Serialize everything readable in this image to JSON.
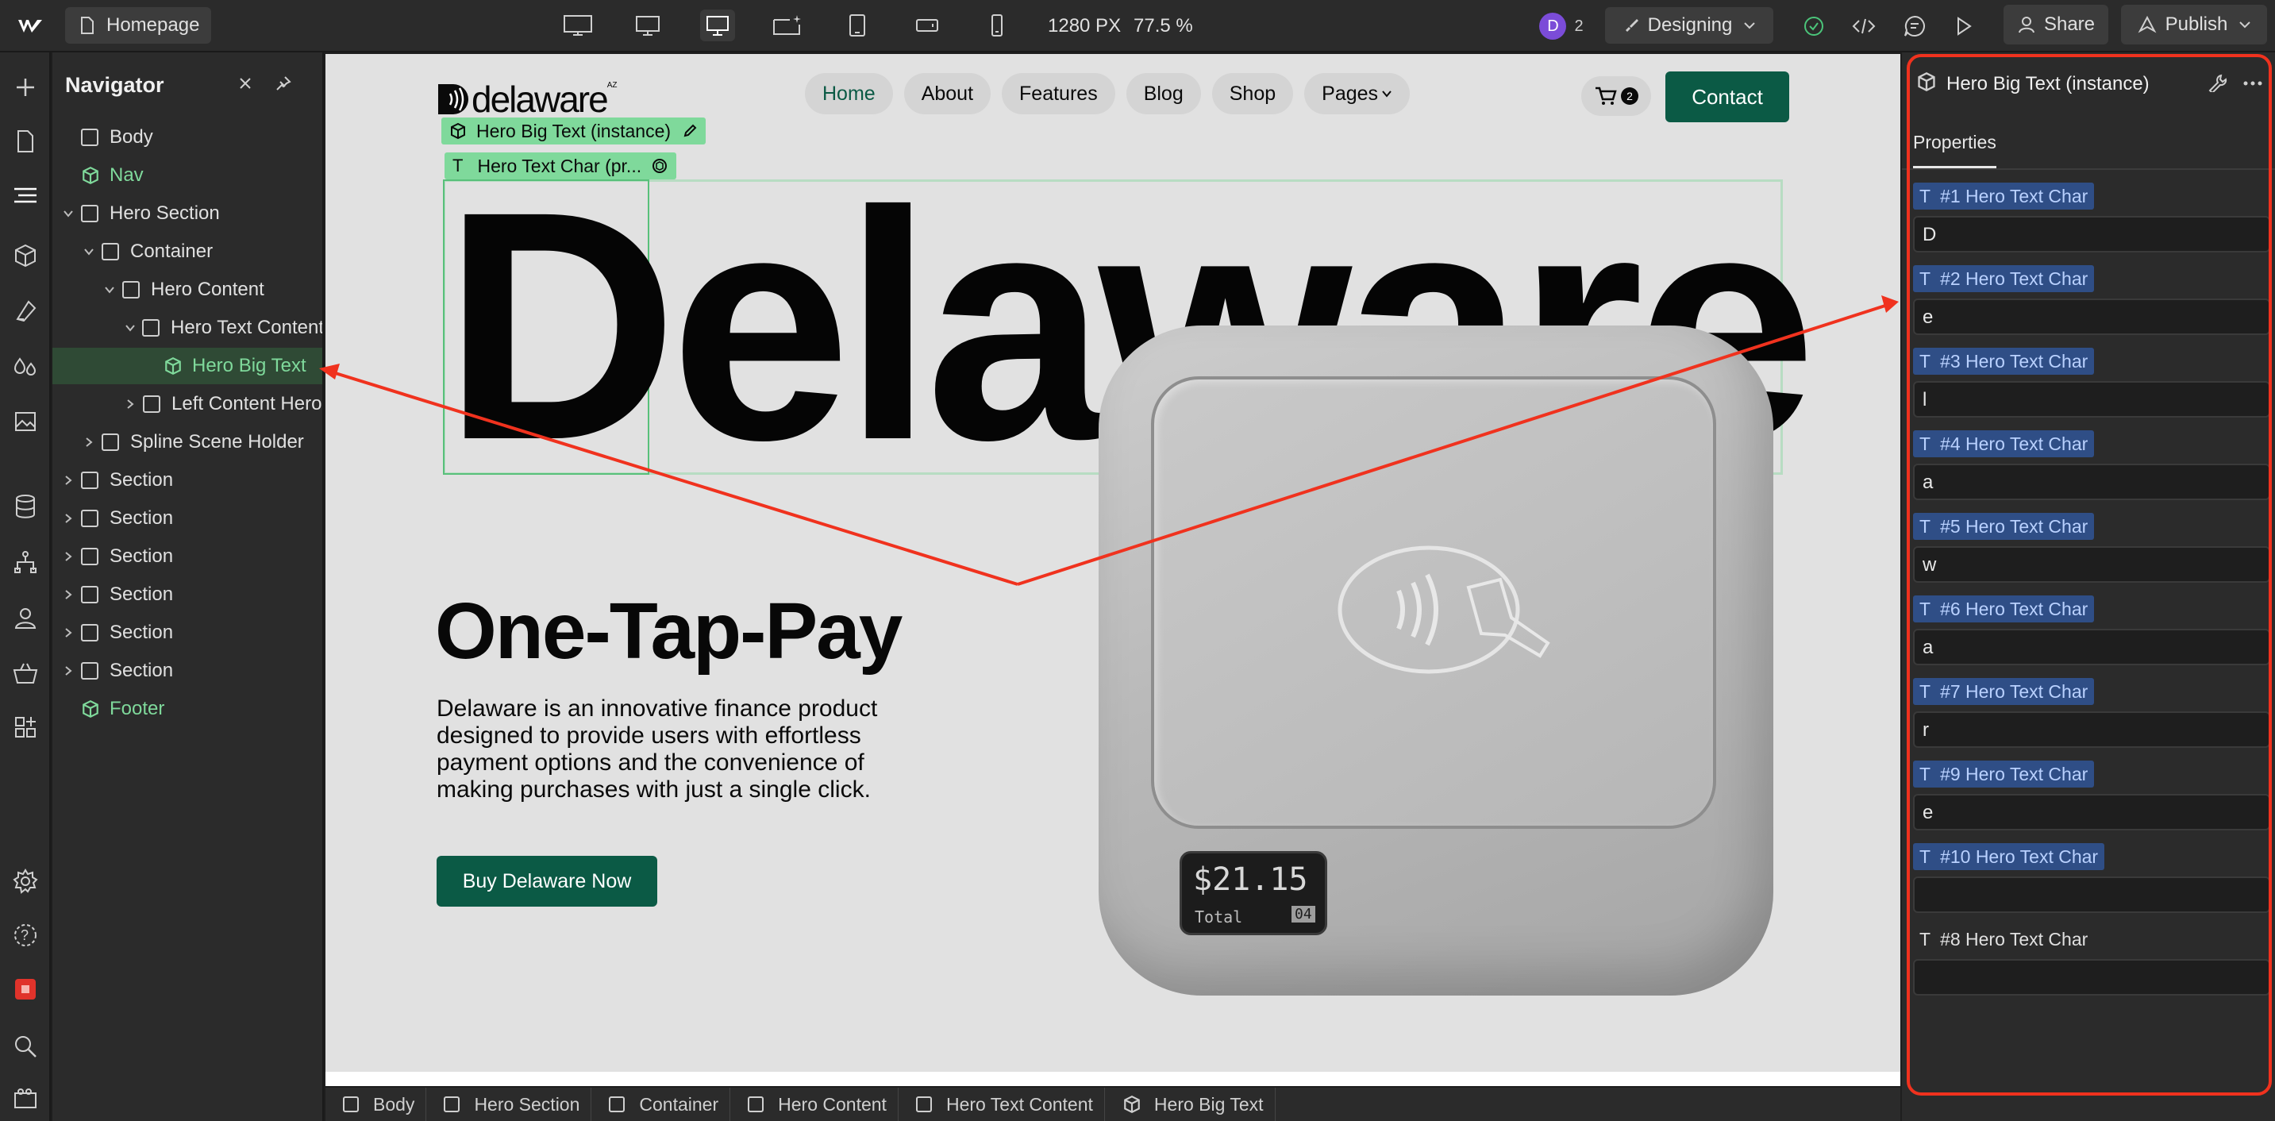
{
  "topbar": {
    "page_name": "Homepage",
    "width_label": "1280 PX",
    "zoom_label": "77.5 %",
    "user_initial": "D",
    "user_count": "2",
    "mode": "Designing",
    "share_label": "Share",
    "publish_label": "Publish",
    "devices": [
      "desktop-xl-icon",
      "desktop-large-icon",
      "desktop-icon",
      "desktop-star-icon",
      "tablet-icon",
      "mobile-landscape-icon",
      "mobile-portrait-icon"
    ]
  },
  "rail_icons": [
    "add-icon",
    "pages-icon",
    "navigator-icon",
    "components-icon",
    "variables-icon",
    "styles-icon",
    "assets-icon",
    "cms-icon",
    "logic-icon",
    "users-icon",
    "ecommerce-icon",
    "apps-icon",
    "settings-icon",
    "help-icon",
    "record-icon",
    "search-icon",
    "video-icon"
  ],
  "navigator": {
    "title": "Navigator",
    "tree": [
      {
        "label": "Body",
        "level": 0,
        "kind": "box",
        "chevron": "none"
      },
      {
        "label": "Nav",
        "level": 0,
        "kind": "component",
        "chevron": "none"
      },
      {
        "label": "Hero Section",
        "level": 0,
        "kind": "box",
        "chevron": "down"
      },
      {
        "label": "Container",
        "level": 1,
        "kind": "box",
        "chevron": "down"
      },
      {
        "label": "Hero Content",
        "level": 2,
        "kind": "box",
        "chevron": "down"
      },
      {
        "label": "Hero Text Content",
        "level": 3,
        "kind": "box",
        "chevron": "down"
      },
      {
        "label": "Hero Big Text",
        "level": 4,
        "kind": "component",
        "chevron": "none",
        "selected": true
      },
      {
        "label": "Left Content Hero",
        "level": 3,
        "kind": "box",
        "chevron": "right"
      },
      {
        "label": "Spline Scene Holder",
        "level": 1,
        "kind": "box",
        "chevron": "right"
      },
      {
        "label": "Section",
        "level": 0,
        "kind": "box",
        "chevron": "right"
      },
      {
        "label": "Section",
        "level": 0,
        "kind": "box",
        "chevron": "right"
      },
      {
        "label": "Section",
        "level": 0,
        "kind": "box",
        "chevron": "right"
      },
      {
        "label": "Section",
        "level": 0,
        "kind": "box",
        "chevron": "right"
      },
      {
        "label": "Section",
        "level": 0,
        "kind": "box",
        "chevron": "right"
      },
      {
        "label": "Section",
        "level": 0,
        "kind": "box",
        "chevron": "right"
      },
      {
        "label": "Footer",
        "level": 0,
        "kind": "component",
        "chevron": "none"
      }
    ]
  },
  "site": {
    "logo_text": "delaware",
    "logo_sup": "AZ",
    "nav_links": [
      "Home",
      "About",
      "Features",
      "Blog",
      "Shop",
      "Pages"
    ],
    "cart_count": "2",
    "contact_label": "Contact",
    "selection_label": "Hero Big Text (instance)",
    "char_label": "Hero Text Char (pr...",
    "big_text": "Delaware",
    "headline": "One-Tap-Pay",
    "paragraph_lines": [
      "Delaware is an innovative finance product",
      "designed to provide users with effortless",
      "payment options and the convenience of",
      "making purchases with just a single click."
    ],
    "cta_label": "Buy Delaware Now",
    "terminal_amount": "$21.15",
    "terminal_total": "Total",
    "terminal_badge": "04"
  },
  "right_panel": {
    "title": "Hero Big Text (instance)",
    "tab": "Properties",
    "props": [
      {
        "label": "#1 Hero Text Char",
        "value": "D",
        "highlight": true
      },
      {
        "label": "#2 Hero Text Char",
        "value": "e",
        "highlight": true
      },
      {
        "label": "#3 Hero Text Char",
        "value": "l",
        "highlight": true
      },
      {
        "label": "#4 Hero Text Char",
        "value": "a",
        "highlight": true
      },
      {
        "label": "#5 Hero Text Char",
        "value": "w",
        "highlight": true
      },
      {
        "label": "#6 Hero Text Char",
        "value": "a",
        "highlight": true
      },
      {
        "label": "#7 Hero Text Char",
        "value": "r",
        "highlight": true
      },
      {
        "label": "#9 Hero Text Char",
        "value": "e",
        "highlight": true
      },
      {
        "label": "#10 Hero Text Char",
        "value": "",
        "highlight": true
      },
      {
        "label": "#8 Hero Text Char",
        "value": "",
        "highlight": false
      }
    ]
  },
  "breadcrumb": [
    {
      "label": "Body",
      "icon": "box"
    },
    {
      "label": "Hero Section",
      "icon": "box"
    },
    {
      "label": "Container",
      "icon": "box"
    },
    {
      "label": "Hero Content",
      "icon": "box"
    },
    {
      "label": "Hero Text Content",
      "icon": "box"
    },
    {
      "label": "Hero Big Text",
      "icon": "component"
    }
  ],
  "colors": {
    "brand_green": "#0b5a45",
    "selection_green": "#7fd99b",
    "annotation_red": "#f0321e",
    "panel_bg": "#2b2b2b",
    "canvas_bg": "#e1e1e1"
  }
}
